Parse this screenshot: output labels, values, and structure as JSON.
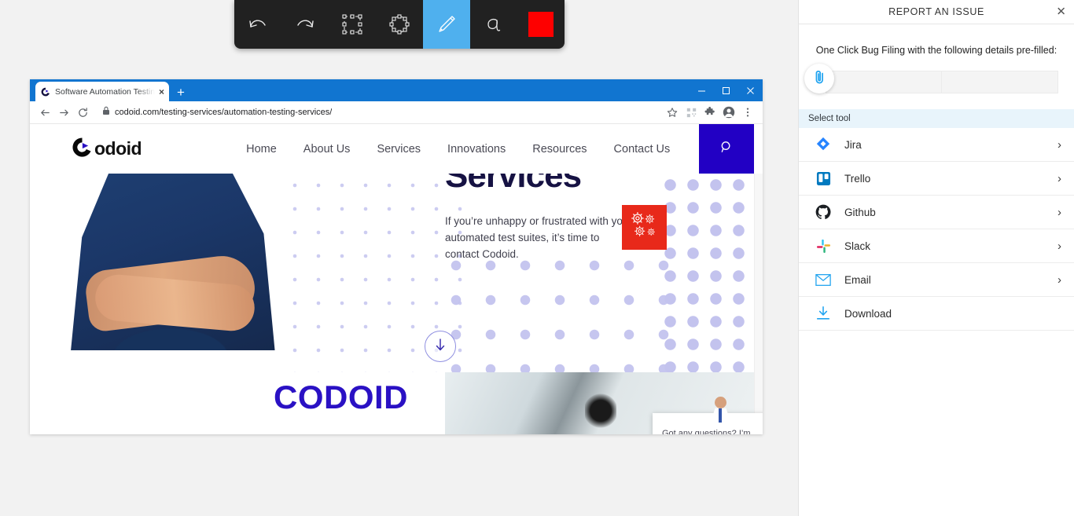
{
  "toolbar": {
    "tools": [
      {
        "name": "undo",
        "icon": "undo-icon",
        "active": false
      },
      {
        "name": "redo",
        "icon": "redo-icon",
        "active": false
      },
      {
        "name": "rectangle-select",
        "icon": "rectangle-select-icon",
        "active": false
      },
      {
        "name": "ellipse-select",
        "icon": "ellipse-select-icon",
        "active": false
      },
      {
        "name": "pencil",
        "icon": "pencil-icon",
        "active": true
      },
      {
        "name": "text",
        "icon": "text-icon",
        "active": false
      }
    ],
    "color_swatch": "#fe0000",
    "active_color": "#4fb0ee",
    "background": "#212121"
  },
  "browser": {
    "tab": {
      "title": "Software Automation Testing | A",
      "favicon": "codoid-favicon",
      "close_label": "×"
    },
    "new_tab_label": "+",
    "window_controls": {
      "minimize": "—",
      "maximize": "□",
      "close": "✕"
    },
    "url": "codoid.com/testing-services/automation-testing-services/",
    "nav_icons": [
      "back-icon",
      "forward-icon",
      "reload-icon"
    ],
    "omnibox_icons": [
      "lock-icon",
      "bookmark-star-icon",
      "qr-icon",
      "extensions-puzzle-icon",
      "profile-avatar-icon",
      "chrome-menu-icon"
    ],
    "titlebar_color": "#1175d0"
  },
  "site": {
    "logo_text": "odoid",
    "menu": [
      {
        "label": "Home"
      },
      {
        "label": "About Us"
      },
      {
        "label": "Services"
      },
      {
        "label": "Innovations"
      },
      {
        "label": "Resources"
      },
      {
        "label": "Contact Us"
      }
    ],
    "search_icon": "search-icon",
    "search_button_color": "#2200c4",
    "hero": {
      "heading": "Services",
      "paragraph": "If you’re unhappy or frustrated with your automated test suites, it’s time to contact Codoid.",
      "badge_icon": "gears-icon",
      "badge_color": "#e8291a",
      "scroll_down_icon": "arrow-down-icon"
    },
    "lower": {
      "wordmark": "CODOID",
      "wordmark_color": "#2a11c4"
    },
    "chat": {
      "message": "Got any questions? I’m happy to help.",
      "close_label": "✕",
      "fab_icon": "chat-bubble-icon",
      "fab_color": "#2b1bb5"
    }
  },
  "panel": {
    "title": "REPORT AN ISSUE",
    "close_label": "✕",
    "description": "One Click Bug Filing with the following details pre-filled:",
    "attach_icon": "paperclip-icon",
    "attach_value": "",
    "select_tool_label": "Select tool",
    "tools": [
      {
        "label": "Jira",
        "icon": "jira-icon",
        "chevron": "›",
        "has_chevron": true
      },
      {
        "label": "Trello",
        "icon": "trello-icon",
        "chevron": "›",
        "has_chevron": true
      },
      {
        "label": "Github",
        "icon": "github-icon",
        "chevron": "›",
        "has_chevron": true
      },
      {
        "label": "Slack",
        "icon": "slack-icon",
        "chevron": "›",
        "has_chevron": true
      },
      {
        "label": "Email",
        "icon": "email-icon",
        "chevron": "›",
        "has_chevron": true
      },
      {
        "label": "Download",
        "icon": "download-icon",
        "chevron": "",
        "has_chevron": false
      }
    ]
  }
}
